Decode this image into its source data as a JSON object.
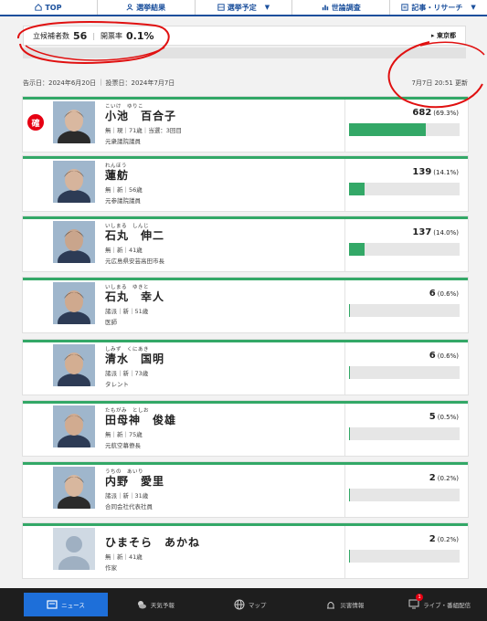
{
  "topnav": {
    "items": [
      {
        "label": "TOP",
        "icon": "home-icon"
      },
      {
        "label": "選挙結果",
        "icon": "person-icon"
      },
      {
        "label": "選挙予定",
        "icon": "grid-icon"
      },
      {
        "label": "世論調査",
        "icon": "chart-icon"
      },
      {
        "label": "記事・リサーチ",
        "icon": "article-icon"
      }
    ]
  },
  "stats": {
    "candidates_label": "立候補者数",
    "candidates_value": "56",
    "turnout_label": "開票率",
    "turnout_value": "0.1%",
    "prefecture": "東京都"
  },
  "dates": {
    "announce": "告示日：2024年6月20日",
    "vote": "投票日：2024年7月7日",
    "updated": "7月7日 20:51 更新"
  },
  "candidates": [
    {
      "kana": "こいけ　ゆりこ",
      "name": "小池　百合子",
      "meta": "無｜現｜71歳｜当選：3回目",
      "career": "元衆議院議員",
      "votes": "682",
      "pct": "(69.3%)",
      "share": 0.693,
      "elected": true
    },
    {
      "kana": "れんほう",
      "name": "蓮舫",
      "meta": "無｜新｜56歳",
      "career": "元参議院議員",
      "votes": "139",
      "pct": "(14.1%)",
      "share": 0.141,
      "elected": false
    },
    {
      "kana": "いしまる　しんじ",
      "name": "石丸　伸二",
      "meta": "無｜新｜41歳",
      "career": "元広島県安芸高田市長",
      "votes": "137",
      "pct": "(14.0%)",
      "share": 0.14,
      "elected": false
    },
    {
      "kana": "いしまる　ゆきと",
      "name": "石丸　幸人",
      "meta": "諸派｜新｜51歳",
      "career": "医師",
      "votes": "6",
      "pct": "(0.6%)",
      "share": 0.006,
      "elected": false
    },
    {
      "kana": "しみず　くにあき",
      "name": "清水　国明",
      "meta": "諸派｜新｜73歳",
      "career": "タレント",
      "votes": "6",
      "pct": "(0.6%)",
      "share": 0.006,
      "elected": false
    },
    {
      "kana": "たもがみ　としお",
      "name": "田母神　俊雄",
      "meta": "無｜新｜75歳",
      "career": "元航空幕僚長",
      "votes": "5",
      "pct": "(0.5%)",
      "share": 0.005,
      "elected": false
    },
    {
      "kana": "うちの　あいり",
      "name": "内野　愛里",
      "meta": "諸派｜新｜31歳",
      "career": "合同会社代表社員",
      "votes": "2",
      "pct": "(0.2%)",
      "share": 0.002,
      "elected": false
    },
    {
      "kana": "",
      "name": "ひまそら　あかね",
      "meta": "無｜新｜41歳",
      "career": "作家",
      "votes": "2",
      "pct": "(0.2%)",
      "share": 0.002,
      "elected": false
    }
  ],
  "elected_badge": "確",
  "bottomnav": {
    "items": [
      {
        "label": "ニュース",
        "icon": "news-icon"
      },
      {
        "label": "天気予報",
        "icon": "weather-icon"
      },
      {
        "label": "マップ",
        "icon": "globe-icon"
      },
      {
        "label": "災害情報",
        "icon": "alert-icon"
      },
      {
        "label": "ライブ・番組配信",
        "icon": "tv-icon"
      }
    ],
    "live_badge": "1"
  },
  "colors": {
    "accent": "#1a4f9c",
    "bar": "#33a867",
    "elected": "#e60012",
    "annotation": "#e01010"
  }
}
